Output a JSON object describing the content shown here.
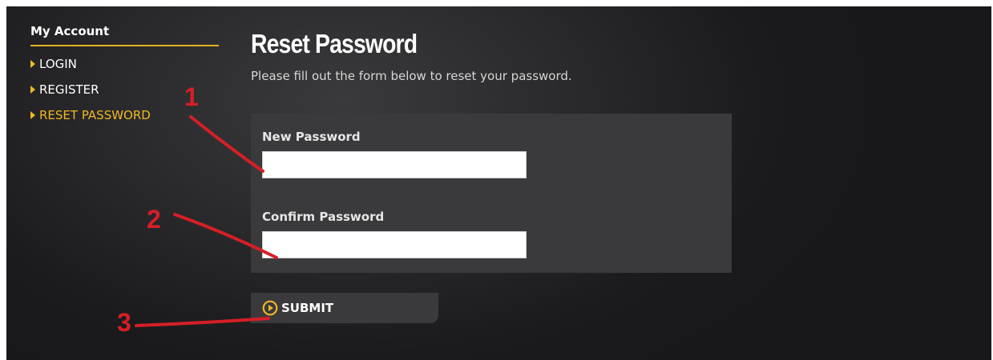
{
  "sidebar": {
    "title": "My Account",
    "items": [
      {
        "label": "LOGIN",
        "active": false
      },
      {
        "label": "REGISTER",
        "active": false
      },
      {
        "label": "RESET PASSWORD",
        "active": true
      }
    ]
  },
  "main": {
    "title": "Reset Password",
    "subtitle": "Please fill out the form below to reset your password.",
    "fields": [
      {
        "label": "New Password",
        "value": ""
      },
      {
        "label": "Confirm Password",
        "value": ""
      }
    ],
    "submit_label": "SUBMIT"
  },
  "annotations": {
    "markers": [
      "1",
      "2",
      "3"
    ],
    "color": "#d61f26"
  },
  "colors": {
    "accent": "#f0b825",
    "background": "#1f1f21",
    "panel": "#3a3a3c"
  }
}
